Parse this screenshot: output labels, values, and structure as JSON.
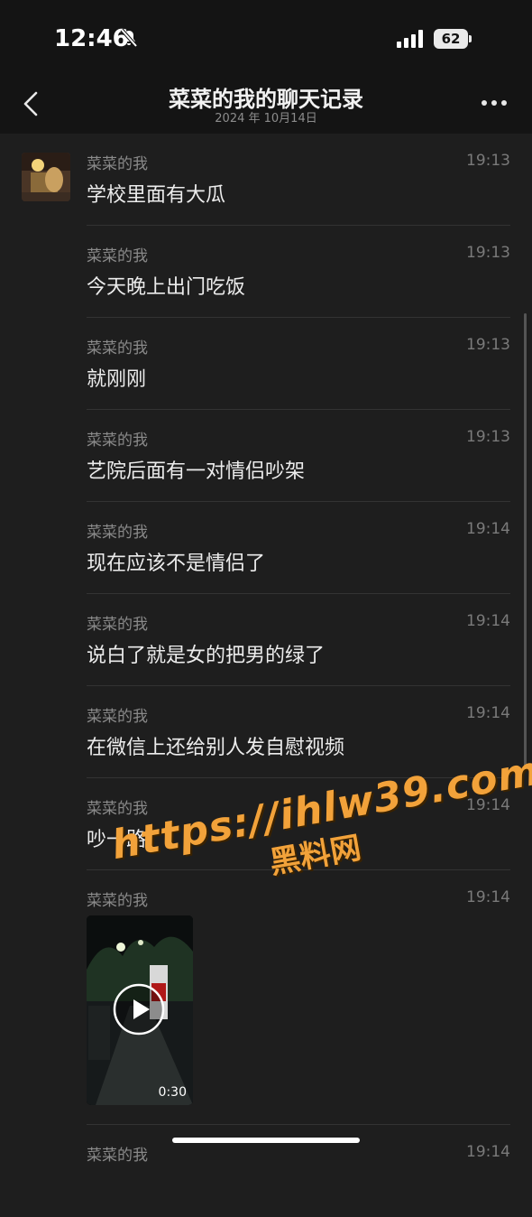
{
  "status_bar": {
    "time": "12:46",
    "battery": "62",
    "mute_icon": "bell-slash-icon",
    "signal_icon": "cellular-signal-icon"
  },
  "header": {
    "title": "菜菜的我的聊天记录",
    "date": "2024 年 10月14日",
    "back_icon": "chevron-left-icon",
    "more_icon": "ellipsis-icon"
  },
  "messages": [
    {
      "sender": "菜菜的我",
      "time": "19:13",
      "text": "学校里面有大瓜"
    },
    {
      "sender": "菜菜的我",
      "time": "19:13",
      "text": "今天晚上出门吃饭"
    },
    {
      "sender": "菜菜的我",
      "time": "19:13",
      "text": "就刚刚"
    },
    {
      "sender": "菜菜的我",
      "time": "19:13",
      "text": "艺院后面有一对情侣吵架"
    },
    {
      "sender": "菜菜的我",
      "time": "19:14",
      "text": "现在应该不是情侣了"
    },
    {
      "sender": "菜菜的我",
      "time": "19:14",
      "text": "说白了就是女的把男的绿了"
    },
    {
      "sender": "菜菜的我",
      "time": "19:14",
      "text": "在微信上还给别人发自慰视频"
    },
    {
      "sender": "菜菜的我",
      "time": "19:14",
      "text": "吵一路"
    },
    {
      "sender": "菜菜的我",
      "time": "19:14",
      "video_duration": "0:30"
    },
    {
      "sender": "菜菜的我",
      "time": "19:14"
    }
  ],
  "watermark": {
    "url": "https://ihlw39.com",
    "text": "黑料网"
  }
}
